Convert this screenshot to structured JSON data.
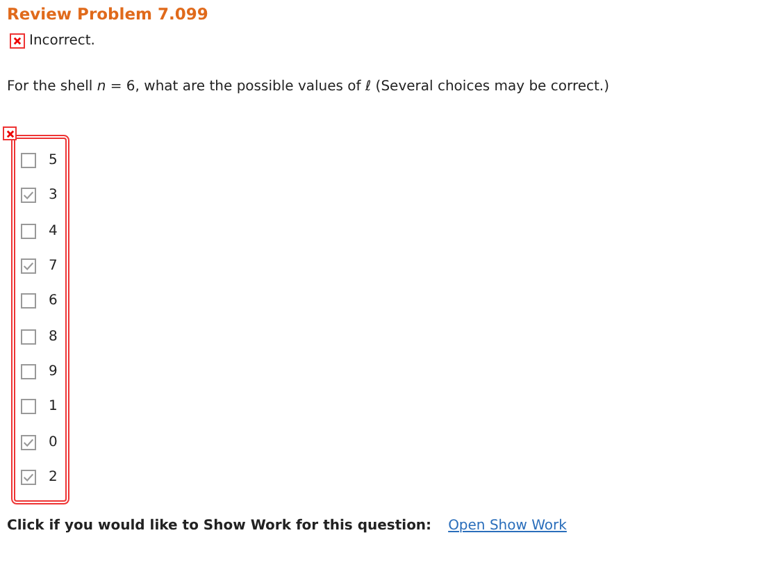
{
  "title": "Review Problem 7.099",
  "result": {
    "correct": false,
    "text": "Incorrect."
  },
  "question": "For the shell *n* = 6, what are the possible values of *ℓ* (Several choices may be correct.)",
  "choices_correct": false,
  "choices": [
    {
      "label": "5",
      "checked": false
    },
    {
      "label": "3",
      "checked": true
    },
    {
      "label": "4",
      "checked": false
    },
    {
      "label": "7",
      "checked": true
    },
    {
      "label": "6",
      "checked": false
    },
    {
      "label": "8",
      "checked": false
    },
    {
      "label": "9",
      "checked": false
    },
    {
      "label": "1",
      "checked": false
    },
    {
      "label": "0",
      "checked": true
    },
    {
      "label": "2",
      "checked": true
    }
  ],
  "show_work": {
    "prompt": "Click if you would like to Show Work for this question:",
    "link": "Open Show Work"
  }
}
